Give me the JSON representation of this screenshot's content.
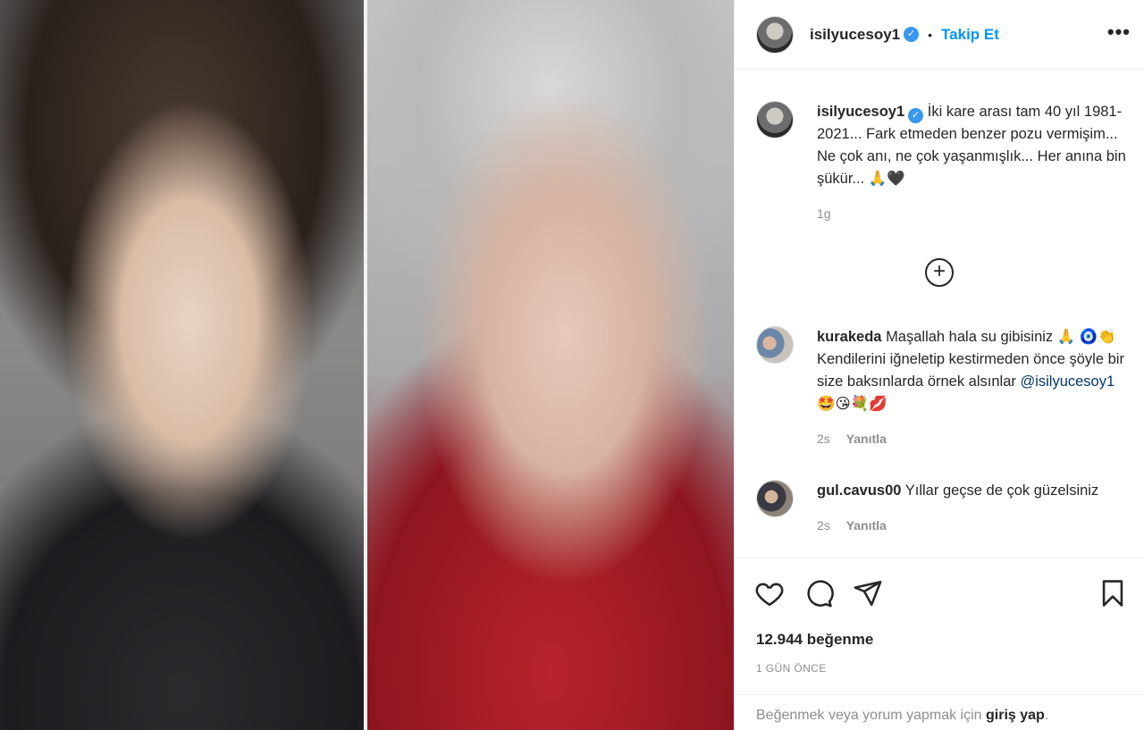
{
  "header": {
    "username": "isilyucesoy1",
    "separator": "•",
    "follow_label": "Takip Et",
    "more_icon": "more-horizontal-icon"
  },
  "caption": {
    "username": "isilyucesoy1",
    "text": "İki kare arası tam 40 yıl 1981- 2021... Fark etmeden benzer pozu vermişim... Ne çok anı, ne çok yaşanmışlık... Her anına bin şükür... 🙏🖤",
    "time": "1g"
  },
  "load_more_icon": "plus-circle-icon",
  "comments": [
    {
      "username": "kurakeda",
      "text_before": "Maşallah hala su gibisiniz 🙏 🧿👏 Kendilerini iğneletip kestirmeden önce şöyle bir size baksınlarda örnek alsınlar ",
      "mention": "@isilyucesoy1",
      "text_after": " 🤩😘💐💋",
      "time": "2s",
      "reply_label": "Yanıtla"
    },
    {
      "username": "gul.cavus00",
      "text": "Yıllar geçse de çok güzelsiniz",
      "time": "2s",
      "reply_label": "Yanıtla"
    }
  ],
  "actions": {
    "like_icon": "heart-icon",
    "comment_icon": "comment-icon",
    "share_icon": "share-icon",
    "save_icon": "bookmark-icon"
  },
  "likes": "12.944 beğenme",
  "posted_ago": "1 GÜN ÖNCE",
  "login_prompt": {
    "text": "Beğenmek veya yorum yapmak için ",
    "link": "giriş yap",
    "end": "."
  }
}
